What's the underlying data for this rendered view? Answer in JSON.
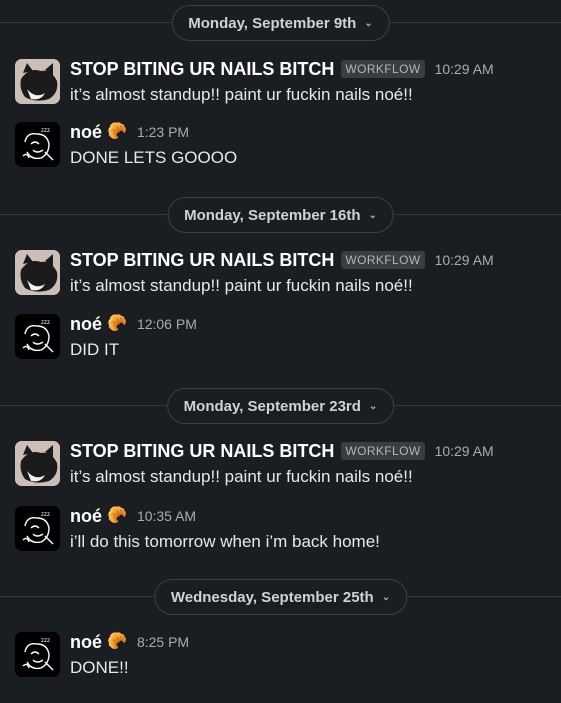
{
  "dividers": [
    {
      "label": "Monday, September 9th"
    },
    {
      "label": "Monday, September 16th"
    },
    {
      "label": "Monday, September 23rd"
    },
    {
      "label": "Wednesday, September 25th"
    }
  ],
  "messages": [
    {
      "author": "STOP BITING UR NAILS BITCH",
      "badge": "WORKFLOW",
      "time": "10:29 AM",
      "text": "it’s almost standup!! paint ur fuckin nails noé!!"
    },
    {
      "author": "noé",
      "time": "1:23 PM",
      "text": "DONE LETS GOOOO"
    },
    {
      "author": "STOP BITING UR NAILS BITCH",
      "badge": "WORKFLOW",
      "time": "10:29 AM",
      "text": "it’s almost standup!! paint ur fuckin nails noé!!"
    },
    {
      "author": "noé",
      "time": "12:06 PM",
      "text": "DID IT"
    },
    {
      "author": "STOP BITING UR NAILS BITCH",
      "badge": "WORKFLOW",
      "time": "10:29 AM",
      "text": "it’s almost standup!! paint ur fuckin nails noé!!"
    },
    {
      "author": "noé",
      "time": "10:35 AM",
      "text": "i’ll do this tomorrow when i’m back home!"
    },
    {
      "author": "noé",
      "time": "8:25 PM",
      "text": "DONE!!"
    }
  ],
  "icons": {
    "divider_chevron": "chevron-down-icon",
    "status_emoji": "croissant-icon",
    "status_glyph": "🥐"
  },
  "colors": {
    "background": "#1a1d21",
    "text": "#d1d2d3",
    "name": "#ffffff",
    "timestamp": "#ababad",
    "badge_bg": "#3a3d42"
  }
}
